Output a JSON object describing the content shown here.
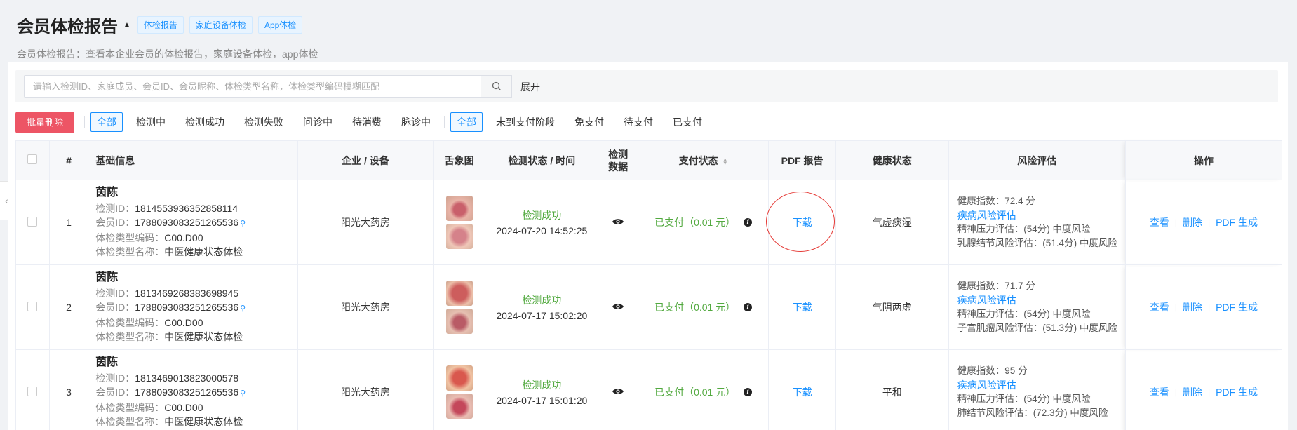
{
  "header": {
    "title": "会员体检报告",
    "tags": [
      "体检报告",
      "家庭设备体检",
      "App体检"
    ],
    "subtitle": "会员体检报告：查看本企业会员的体检报告，家庭设备体检，app体检"
  },
  "search": {
    "placeholder": "请输入检测ID、家庭成员、会员ID、会员昵称、体检类型名称，体检类型编码模糊匹配",
    "expand_label": "展开"
  },
  "filters": {
    "batch_delete": "批量删除",
    "status_group": [
      "全部",
      "检测中",
      "检测成功",
      "检测失败",
      "问诊中",
      "待消费",
      "脉诊中"
    ],
    "pay_group": [
      "全部",
      "未到支付阶段",
      "免支付",
      "待支付",
      "已支付"
    ]
  },
  "table": {
    "headers": {
      "index": "#",
      "basic": "基础信息",
      "device": "企业 / 设备",
      "tongue": "舌象图",
      "status_time": "检测状态 / 时间",
      "data": "检测数据",
      "pay": "支付状态",
      "pdf": "PDF 报告",
      "health": "健康状态",
      "risk": "风险评估",
      "ops": "操作"
    },
    "labels": {
      "detect_id": "检测ID：",
      "member_id": "会员ID：",
      "type_code": "体检类型编码：",
      "type_name": "体检类型名称："
    },
    "rows": [
      {
        "index": "1",
        "name": "茵陈",
        "detect_id": "1814553936352858114",
        "member_id": "1788093083251265536",
        "type_code": "C00.D00",
        "type_name": "中医健康状态体检",
        "device": "阳光大药房",
        "status": "检测成功",
        "time": "2024-07-20 14:52:25",
        "pay": "已支付（0.01 元）",
        "pdf": "下载",
        "health": "气虚痰湿",
        "risk": [
          "健康指数：72.4 分",
          "疾病风险评估",
          "精神压力评估：(54分) 中度风险",
          "乳腺结节风险评估：(51.4分) 中度风险"
        ]
      },
      {
        "index": "2",
        "name": "茵陈",
        "detect_id": "1813469268383698945",
        "member_id": "1788093083251265536",
        "type_code": "C00.D00",
        "type_name": "中医健康状态体检",
        "device": "阳光大药房",
        "status": "检测成功",
        "time": "2024-07-17 15:02:20",
        "pay": "已支付（0.01 元）",
        "pdf": "下载",
        "health": "气阴两虚",
        "risk": [
          "健康指数：71.7 分",
          "疾病风险评估",
          "精神压力评估：(54分) 中度风险",
          "子宫肌瘤风险评估：(51.3分) 中度风险"
        ]
      },
      {
        "index": "3",
        "name": "茵陈",
        "detect_id": "1813469013823000578",
        "member_id": "1788093083251265536",
        "type_code": "C00.D00",
        "type_name": "中医健康状态体检",
        "device": "阳光大药房",
        "status": "检测成功",
        "time": "2024-07-17 15:01:20",
        "pay": "已支付（0.01 元）",
        "pdf": "下载",
        "health": "平和",
        "risk": [
          "健康指数：95 分",
          "疾病风险评估",
          "精神压力评估：(54分) 中度风险",
          "肺结节风险评估：(72.3分) 中度风险"
        ]
      }
    ],
    "ops": [
      "查看",
      "删除",
      "PDF 生成"
    ]
  },
  "colors": {
    "accent": "#1890ff",
    "success": "#52a93f",
    "danger": "#ed5565"
  }
}
